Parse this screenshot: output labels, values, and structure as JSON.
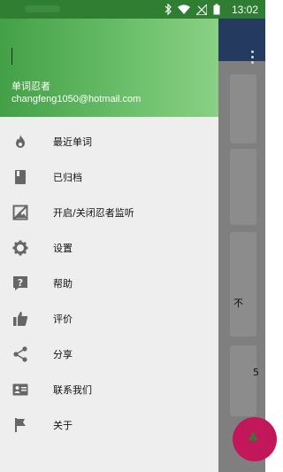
{
  "status_bar": {
    "time": "13:02"
  },
  "drawer": {
    "header": {
      "app_name": "单词忍者",
      "email": "changfeng1050@hotmail.com"
    },
    "menu": [
      {
        "label": "最近单词",
        "icon": "flame-icon"
      },
      {
        "label": "已归档",
        "icon": "book-icon"
      },
      {
        "label": "开启/关闭忍者监听",
        "icon": "image-icon"
      },
      {
        "label": "设置",
        "icon": "gear-icon"
      },
      {
        "label": "帮助",
        "icon": "help-icon"
      },
      {
        "label": "评价",
        "icon": "thumbs-up-icon"
      },
      {
        "label": "分享",
        "icon": "share-icon"
      },
      {
        "label": "联系我们",
        "icon": "contact-card-icon"
      },
      {
        "label": "关于",
        "icon": "flag-icon"
      }
    ]
  },
  "background": {
    "partial_text_1": "不",
    "partial_text_2": "5"
  },
  "colors": {
    "header_start": "#43a047",
    "header_end": "#8ad085",
    "fab": "#c2185b",
    "toolbar": "#253a5f"
  }
}
